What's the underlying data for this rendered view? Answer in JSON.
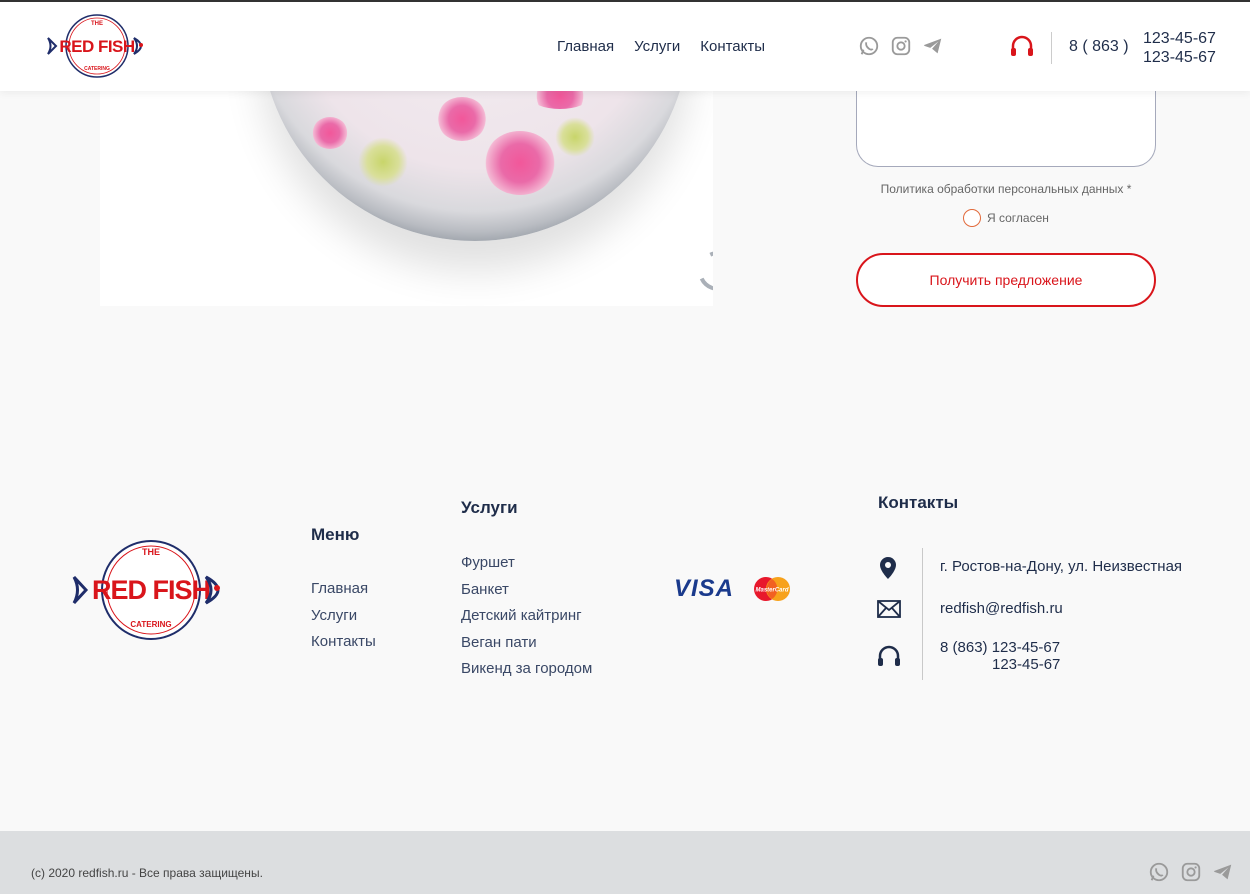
{
  "header": {
    "logo": {
      "small_text_top": "THE",
      "brand": "RED FISH",
      "small_text_bottom": "CATERING"
    },
    "nav": [
      "Главная",
      "Услуги",
      "Контакты"
    ],
    "social_icons": [
      "whatsapp-icon",
      "instagram-icon",
      "telegram-icon"
    ],
    "phone": {
      "prefix": "8 ( 863 )",
      "numbers": [
        "123-45-67",
        "123-45-67"
      ]
    },
    "colors": {
      "accent": "#d9151b",
      "nav_text": "#1f2d4a"
    }
  },
  "form": {
    "policy_label": "Политика обработки персональных данных *",
    "agree_label": "Я согласен",
    "submit_label": "Получить предложение"
  },
  "footer": {
    "menu": {
      "title": "Меню",
      "items": [
        "Главная",
        "Услуги",
        "Контакты"
      ]
    },
    "services": {
      "title": "Услуги",
      "items": [
        "Фуршет",
        "Банкет",
        "Детский кайтринг",
        "Веган пати",
        "Викенд за городом"
      ]
    },
    "payments": {
      "visa": "VISA",
      "mastercard": "MasterCard"
    },
    "contacts": {
      "title": "Контакты",
      "address": "г. Ростов-на-Дону, ул. Неизвестная",
      "email": "redfish@redfish.ru",
      "phone_line1": "8 (863) 123-45-67",
      "phone_line2": "123-45-67"
    }
  },
  "bottom": {
    "copyright": "(c) 2020 redfish.ru - Все права защищены.",
    "social_icons": [
      "whatsapp-icon",
      "instagram-icon",
      "telegram-icon"
    ]
  }
}
